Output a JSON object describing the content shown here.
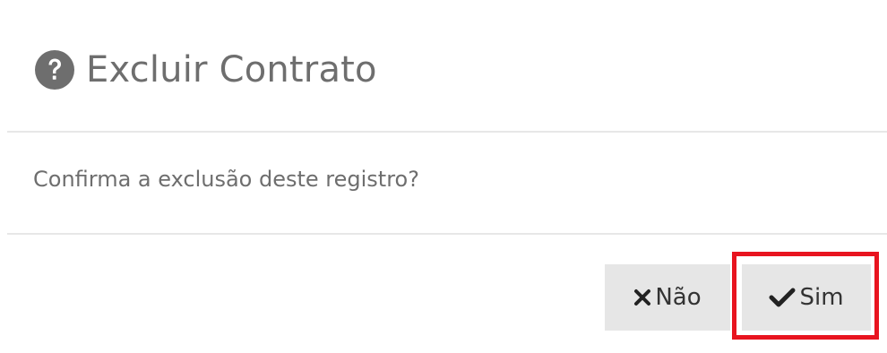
{
  "dialog": {
    "title": "Excluir Contrato",
    "message": "Confirma a exclusão deste registro?",
    "buttons": {
      "no_label": "Não",
      "yes_label": "Sim"
    }
  },
  "icons": {
    "title_icon": "question-circle-icon",
    "no_icon": "times-icon",
    "yes_icon": "check-icon"
  },
  "colors": {
    "text": "#6e6e6e",
    "button_bg": "#e6e6e6",
    "button_text": "#333333",
    "highlight": "#e8141f"
  }
}
